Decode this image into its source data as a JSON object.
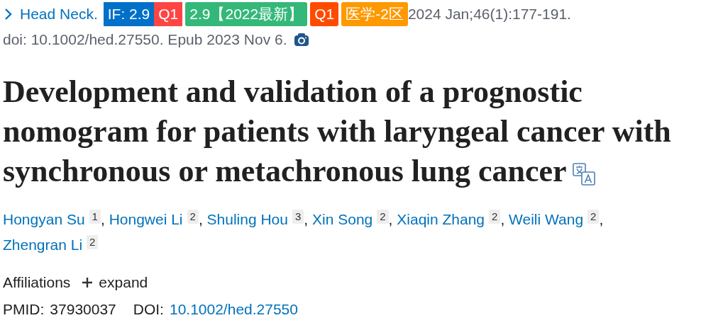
{
  "citation": {
    "journal": "Head Neck.",
    "badges": [
      {
        "text": "IF: 2.9",
        "color": "#0070c9",
        "rounded": false
      },
      {
        "text": "Q1",
        "color": "#ff4444",
        "rounded": false
      },
      {
        "text": "2.9【2022最新】",
        "color": "#34b87a",
        "rounded": true
      },
      {
        "text": "Q1",
        "color": "#ff4b00",
        "rounded": true
      },
      {
        "text": "医学-2区",
        "color": "#ff9900",
        "rounded": true
      }
    ],
    "issue": "2024 Jan;46(1):177-191.",
    "doi_line": "doi: 10.1002/hed.27550. Epub 2023 Nov 6."
  },
  "title": "Development and validation of a prognostic nomogram for patients with laryngeal cancer with synchronous or metachronous lung cancer",
  "authors": [
    {
      "name": "Hongyan Su",
      "affiliation": "1",
      "separator": ","
    },
    {
      "name": "Hongwei Li",
      "affiliation": "2",
      "separator": ","
    },
    {
      "name": "Shuling Hou",
      "affiliation": "3",
      "separator": ","
    },
    {
      "name": "Xin Song",
      "affiliation": "2",
      "separator": ","
    },
    {
      "name": "Xiaqin Zhang",
      "affiliation": "2",
      "separator": ","
    },
    {
      "name": "Weili Wang",
      "affiliation": "2",
      "separator": ","
    },
    {
      "name": "Zhengran Li",
      "affiliation": "2"
    }
  ],
  "affiliations": {
    "label": "Affiliations",
    "toggle": "expand",
    "expanded": false
  },
  "ids": {
    "pmid_label": "PMID:",
    "pmid": "37930037",
    "doi_label": "DOI:",
    "doi": "10.1002/hed.27550"
  }
}
